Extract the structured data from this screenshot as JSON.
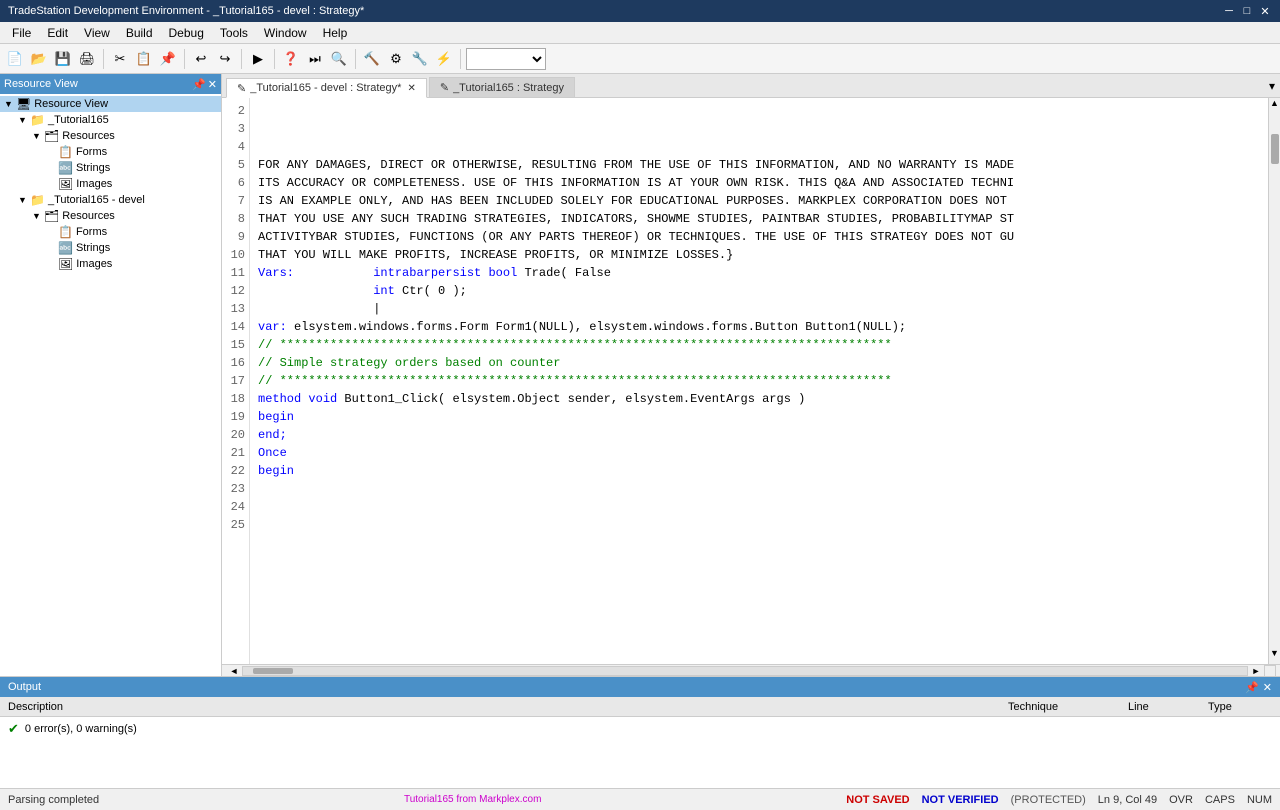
{
  "titleBar": {
    "title": "TradeStation Development Environment - _Tutorial165 - devel : Strategy*",
    "controls": [
      "─",
      "□",
      "✕"
    ]
  },
  "menuBar": {
    "items": [
      "File",
      "Edit",
      "View",
      "Build",
      "Debug",
      "Tools",
      "Window",
      "Help"
    ]
  },
  "resourcePanel": {
    "title": "Resource View",
    "tree": [
      {
        "id": "rv",
        "label": "Resource View",
        "level": 0,
        "type": "root",
        "expanded": true
      },
      {
        "id": "t165",
        "label": "_Tutorial165",
        "level": 1,
        "type": "folder",
        "expanded": true
      },
      {
        "id": "res1",
        "label": "Resources",
        "level": 2,
        "type": "resources",
        "expanded": true
      },
      {
        "id": "forms1",
        "label": "Forms",
        "level": 3,
        "type": "item"
      },
      {
        "id": "strings1",
        "label": "Strings",
        "level": 3,
        "type": "item"
      },
      {
        "id": "images1",
        "label": "Images",
        "level": 3,
        "type": "item"
      },
      {
        "id": "t165d",
        "label": "_Tutorial165 - devel",
        "level": 1,
        "type": "folder",
        "expanded": true
      },
      {
        "id": "res2",
        "label": "Resources",
        "level": 2,
        "type": "resources",
        "expanded": true
      },
      {
        "id": "forms2",
        "label": "Forms",
        "level": 3,
        "type": "item"
      },
      {
        "id": "strings2",
        "label": "Strings",
        "level": 3,
        "type": "item"
      },
      {
        "id": "images2",
        "label": "Images",
        "level": 3,
        "type": "item"
      }
    ]
  },
  "tabs": [
    {
      "id": "tab1",
      "label": "_Tutorial165 - devel : Strategy*",
      "active": true,
      "icon": "✎"
    },
    {
      "id": "tab2",
      "label": "_Tutorial165 : Strategy",
      "active": false,
      "icon": "✎"
    }
  ],
  "codeLines": [
    {
      "num": 2,
      "text": "FOR ANY DAMAGES, DIRECT OR OTHERWISE, RESULTING FROM THE USE OF THIS INFORMATION, AND NO WARRANTY IS MADE "
    },
    {
      "num": 3,
      "text": "ITS ACCURACY OR COMPLETENESS. USE OF THIS INFORMATION IS AT YOUR OWN RISK. THIS Q&A AND ASSOCIATED TECHNI"
    },
    {
      "num": 4,
      "text": "IS AN EXAMPLE ONLY, AND HAS BEEN INCLUDED SOLELY FOR EDUCATIONAL PURPOSES. MARKPLEX CORPORATION DOES NOT "
    },
    {
      "num": 5,
      "text": "THAT YOU USE ANY SUCH TRADING STRATEGIES, INDICATORS, SHOWME STUDIES, PAINTBAR STUDIES, PROBABILITYMAP ST"
    },
    {
      "num": 6,
      "text": "ACTIVITYBAR STUDIES, FUNCTIONS (OR ANY PARTS THEREOF) OR TECHNIQUES. THE USE OF THIS STRATEGY DOES NOT GU"
    },
    {
      "num": 7,
      "text": "THAT YOU WILL MAKE PROFITS, INCREASE PROFITS, OR MINIMIZE LOSSES.}"
    },
    {
      "num": 8,
      "text": ""
    },
    {
      "num": 9,
      "text": "Vars:           intrabarpersist bool Trade( False"
    },
    {
      "num": 10,
      "text": "                int Ctr( 0 );"
    },
    {
      "num": 11,
      "text": "                |"
    },
    {
      "num": 12,
      "text": ""
    },
    {
      "num": 13,
      "text": "var: elsystem.windows.forms.Form Form1(NULL), elsystem.windows.forms.Button Button1(NULL);"
    },
    {
      "num": 14,
      "text": ""
    },
    {
      "num": 15,
      "text": "// *************************************************************************************"
    },
    {
      "num": 16,
      "text": "// Simple strategy orders based on counter"
    },
    {
      "num": 17,
      "text": "// *************************************************************************************"
    },
    {
      "num": 18,
      "text": "method void Button1_Click( elsystem.Object sender, elsystem.EventArgs args )"
    },
    {
      "num": 19,
      "text": "begin"
    },
    {
      "num": 20,
      "text": ""
    },
    {
      "num": 21,
      "text": "end;"
    },
    {
      "num": 22,
      "text": ""
    },
    {
      "num": 23,
      "text": ""
    },
    {
      "num": 24,
      "text": "Once"
    },
    {
      "num": 25,
      "text": "begin"
    }
  ],
  "output": {
    "title": "Output",
    "columns": {
      "description": "Description",
      "technique": "Technique",
      "line": "Line",
      "type": "Type"
    },
    "status": "0 error(s), 0 warning(s)"
  },
  "statusBar": {
    "left": "Parsing completed",
    "center": "Tutorial165 from Markplex.com",
    "notSaved": "NOT SAVED",
    "notVerified": "NOT VERIFIED",
    "protected": "(PROTECTED)",
    "position": "Ln 9, Col 49",
    "ovr": "OVR",
    "caps": "CAPS",
    "num": "NUM"
  }
}
